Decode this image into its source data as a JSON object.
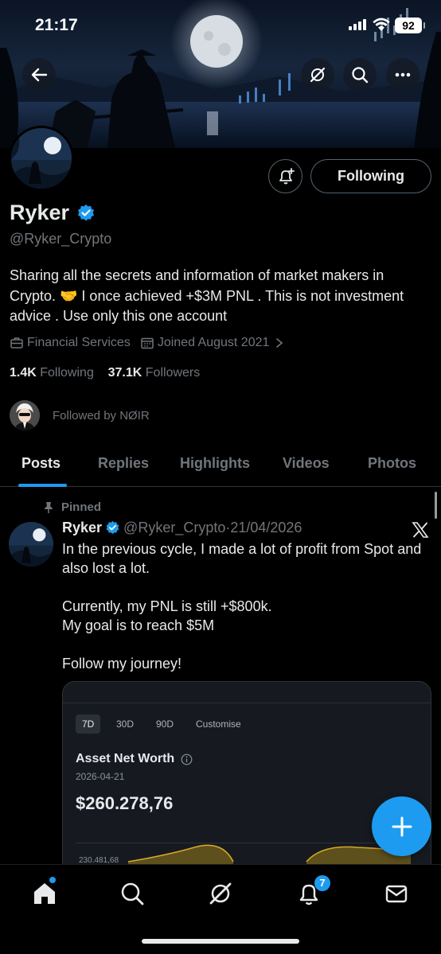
{
  "status_bar": {
    "time": "21:17",
    "battery": "92"
  },
  "profile": {
    "name": "Ryker",
    "handle": "@Ryker_Crypto",
    "bio": "Sharing all the secrets and information of market makers in Crypto. 🤝 I once achieved +$3M PNL . This is not investment advice . Use only this one account",
    "category": "Financial Services",
    "joined": "Joined August 2021",
    "following_count": "1.4K",
    "following_label": "Following",
    "followers_count": "37.1K",
    "followers_label": "Followers",
    "followed_by": "Followed by NØIR",
    "follow_button_label": "Following"
  },
  "tabs": [
    {
      "label": "Posts"
    },
    {
      "label": "Replies"
    },
    {
      "label": "Highlights"
    },
    {
      "label": "Videos"
    },
    {
      "label": "Photos"
    }
  ],
  "post": {
    "pinned_label": "Pinned",
    "author_name": "Ryker",
    "author_handle": "@Ryker_Crypto",
    "date": "·21/04/2026",
    "text": "In the previous cycle, I made a lot of profit from Spot and also lost a lot.\n\nCurrently, my PNL is still +$800k.\nMy goal is to reach $5M\n\nFollow my journey!",
    "card": {
      "ranges": [
        "7D",
        "30D",
        "90D",
        "Customise"
      ],
      "title": "Asset Net Worth",
      "date": "2026-04-21",
      "value": "$260.278,76",
      "axis_label": "230.481,68"
    }
  },
  "nav": {
    "notifications_badge": "7"
  },
  "icons": {
    "back": "arrow-left-icon",
    "grok": "grok-icon",
    "search": "search-icon",
    "more": "more-icon",
    "notify": "bell-plus-icon",
    "verified": "verified-badge-icon",
    "briefcase": "briefcase-icon",
    "calendar": "calendar-icon",
    "pin": "pin-icon",
    "x": "x-logo-icon",
    "compose": "plus-icon",
    "home": "home-icon",
    "explore": "search-icon",
    "grok_nav": "grok-icon",
    "notifications": "bell-icon",
    "messages": "mail-icon"
  },
  "colors": {
    "accent": "#1d9bf0",
    "text": "#e7e9ea",
    "muted": "#71767b",
    "background": "#000000"
  }
}
